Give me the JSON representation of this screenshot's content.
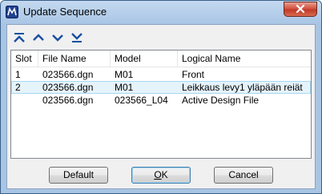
{
  "window": {
    "title": "Update Sequence"
  },
  "toolbar": {
    "buttons": [
      {
        "icon": "move-to-top-icon"
      },
      {
        "icon": "move-up-icon"
      },
      {
        "icon": "move-down-icon"
      },
      {
        "icon": "move-to-bottom-icon"
      }
    ]
  },
  "table": {
    "columns": [
      "Slot",
      "File Name",
      "Model",
      "Logical Name"
    ],
    "rows": [
      {
        "slot": "1",
        "file": "023566.dgn",
        "model": "M01",
        "logical": "Front"
      },
      {
        "slot": "2",
        "file": "023566.dgn",
        "model": "M01",
        "logical": "Leikkaus levy1 yläpään reiät"
      },
      {
        "slot": "",
        "file": "023566.dgn",
        "model": "023566_L04",
        "logical": "Active Design File"
      }
    ],
    "selected_row": 1
  },
  "buttons": {
    "default_label": "Default",
    "ok_label_first": "O",
    "ok_label_rest": "K",
    "cancel_label": "Cancel"
  },
  "colors": {
    "accent": "#1a4fa0",
    "selection": "#e5f3fb",
    "close_button": "#c23a28"
  }
}
